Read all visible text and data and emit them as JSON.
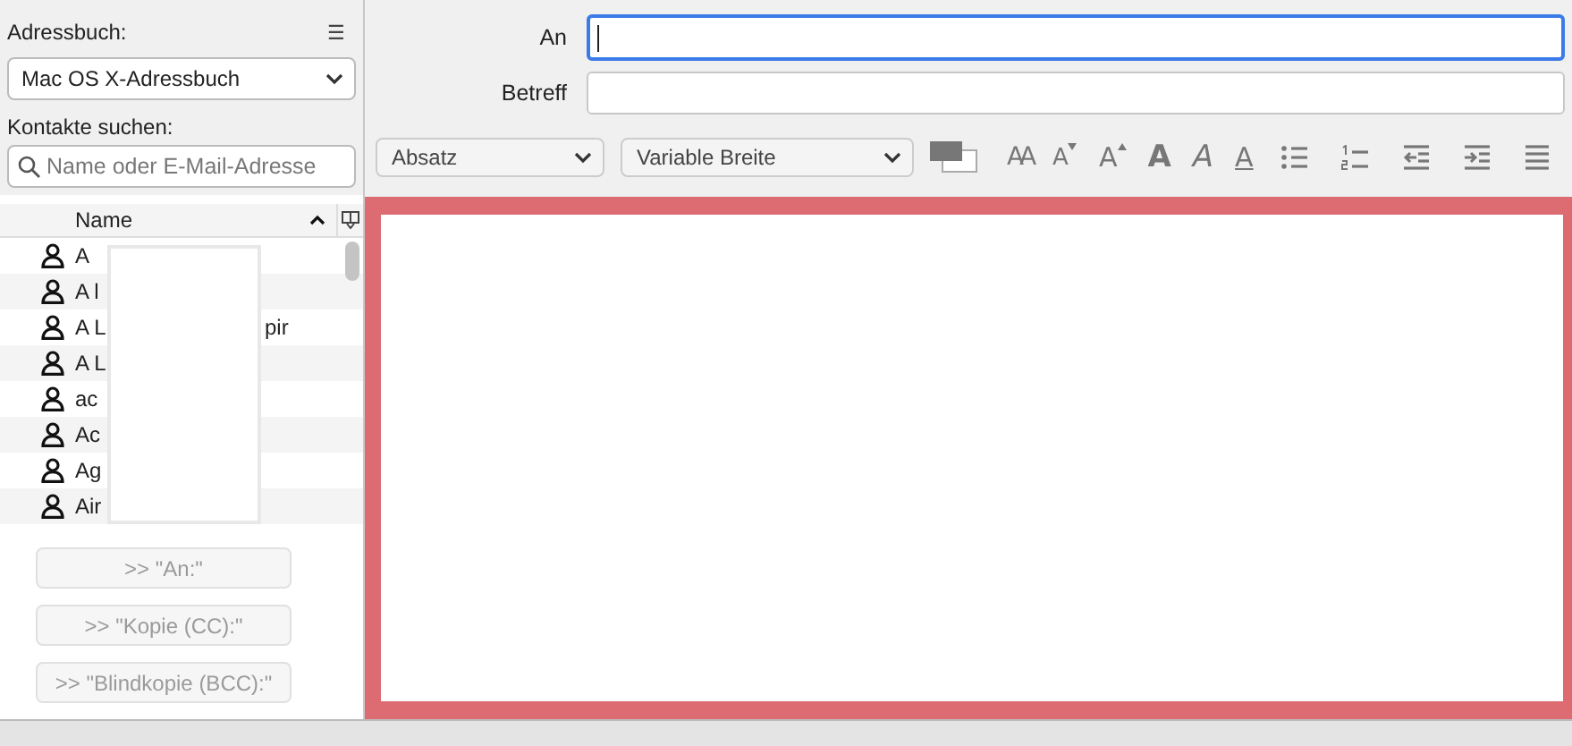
{
  "sidebar": {
    "addressbook_label": "Adressbuch:",
    "addressbook": "Mac OS X-Adressbuch",
    "menu_glyph": "☰",
    "search_label": "Kontakte suchen:",
    "search": {
      "placeholder": "Name oder E-Mail-Adresse"
    },
    "contacts": {
      "column": "Name",
      "sort_ascending": true,
      "rows": [
        {
          "name": "A"
        },
        {
          "name": "A l"
        },
        {
          "name": "A L",
          "tail": "pir"
        },
        {
          "name": "A L"
        },
        {
          "name": "ac"
        },
        {
          "name": "Ac"
        },
        {
          "name": "Ag"
        },
        {
          "name": "Air"
        }
      ]
    },
    "buttons": [
      {
        "label": ">> \"An:\"",
        "disabled": true
      },
      {
        "label": ">> \"Kopie (CC):\"",
        "disabled": true
      },
      {
        "label": ">> \"Blindkopie (BCC):\"",
        "disabled": true
      }
    ]
  },
  "fields": [
    {
      "label": "An",
      "focused": true
    },
    {
      "label": "Betreff",
      "focused": false
    }
  ],
  "toolbar": {
    "paragraph": "Absatz",
    "font": "Variable Breite",
    "tools": [
      {
        "kind": "colors"
      },
      {
        "kind": "reset",
        "glyph": "AA"
      },
      {
        "kind": "smaller",
        "glyph": "A"
      },
      {
        "kind": "larger",
        "glyph": "A"
      },
      {
        "kind": "bold",
        "glyph": "A"
      },
      {
        "kind": "italic",
        "glyph": "A"
      },
      {
        "kind": "underline",
        "glyph": "A"
      },
      {
        "kind": "bullets"
      },
      {
        "kind": "numbers"
      },
      {
        "kind": "outdent"
      },
      {
        "kind": "indent"
      },
      {
        "kind": "align"
      }
    ]
  }
}
